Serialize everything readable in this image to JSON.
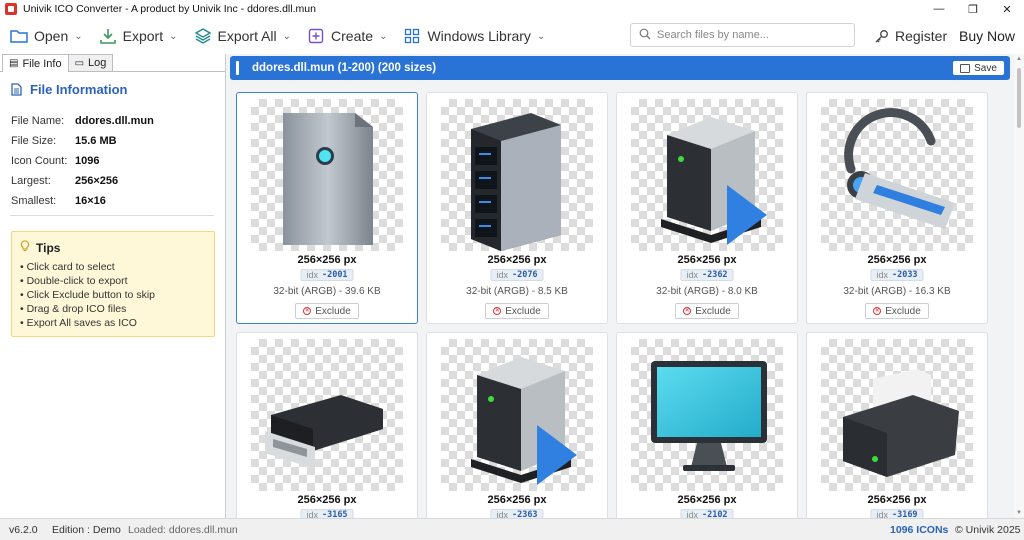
{
  "window": {
    "title": "Univik ICO Converter - A product by Univik Inc - ddores.dll.mun",
    "controls": [
      "—",
      "❐",
      "✕"
    ]
  },
  "toolbar": {
    "open": "Open",
    "export": "Export",
    "export_all": "Export All",
    "create": "Create",
    "windows_library": "Windows Library",
    "search_placeholder": "Search files by name...",
    "register": "Register",
    "buy_now": "Buy Now"
  },
  "left_panel": {
    "tabs": [
      "File Info",
      "Log"
    ],
    "title": "File Information",
    "file_name_label": "File Name:",
    "file_name": "ddores.dll.mun",
    "file_size_label": "File Size:",
    "file_size": "15.6 MB",
    "icon_count_label": "Icon Count:",
    "icon_count": "1096",
    "largest_label": "Largest:",
    "largest": "256×256",
    "smallest_label": "Smallest:",
    "smallest": "16×16",
    "tips_title": "Tips",
    "tips": [
      "• Click card to select",
      "• Double-click to export",
      "• Click Exclude button to skip",
      "• Drag & drop ICO files",
      "• Export All saves as ICO"
    ]
  },
  "main": {
    "header_title": "ddores.dll.mun (1-200) (200 sizes)",
    "save_label": "Save",
    "idx_label": "idx",
    "exclude_label": "Exclude",
    "cards": [
      {
        "size": "256×256 px",
        "idx": "-2001",
        "meta": "32-bit (ARGB) - 39.6 KB",
        "icon": "tower-drive-icon",
        "selected": true
      },
      {
        "size": "256×256 px",
        "idx": "-2076",
        "meta": "32-bit (ARGB) - 8.5 KB",
        "icon": "server-rack-icon"
      },
      {
        "size": "256×256 px",
        "idx": "-2362",
        "meta": "32-bit (ARGB) - 8.0 KB",
        "icon": "media-server-icon"
      },
      {
        "size": "256×256 px",
        "idx": "-2033",
        "meta": "32-bit (ARGB) - 16.3 KB",
        "icon": "bluetooth-headset-icon"
      },
      {
        "size": "256×256 px",
        "idx": "-3165",
        "icon": "cd-drive-icon"
      },
      {
        "size": "256×256 px",
        "idx": "-2363",
        "icon": "media-server-icon"
      },
      {
        "size": "256×256 px",
        "idx": "-2102",
        "icon": "monitor-icon"
      },
      {
        "size": "256×256 px",
        "idx": "-3169",
        "icon": "receipt-printer-icon"
      }
    ]
  },
  "status": {
    "version": "v6.2.0",
    "edition": "Edition : Demo",
    "loaded": "Loaded: ddores.dll.mun",
    "count": "1096 ICONs",
    "copyright": "© Univik 2025"
  },
  "colors": {
    "accent": "#2a73d6",
    "selected_border": "#3b7fd0",
    "tips_bg": "#fff8d8"
  }
}
